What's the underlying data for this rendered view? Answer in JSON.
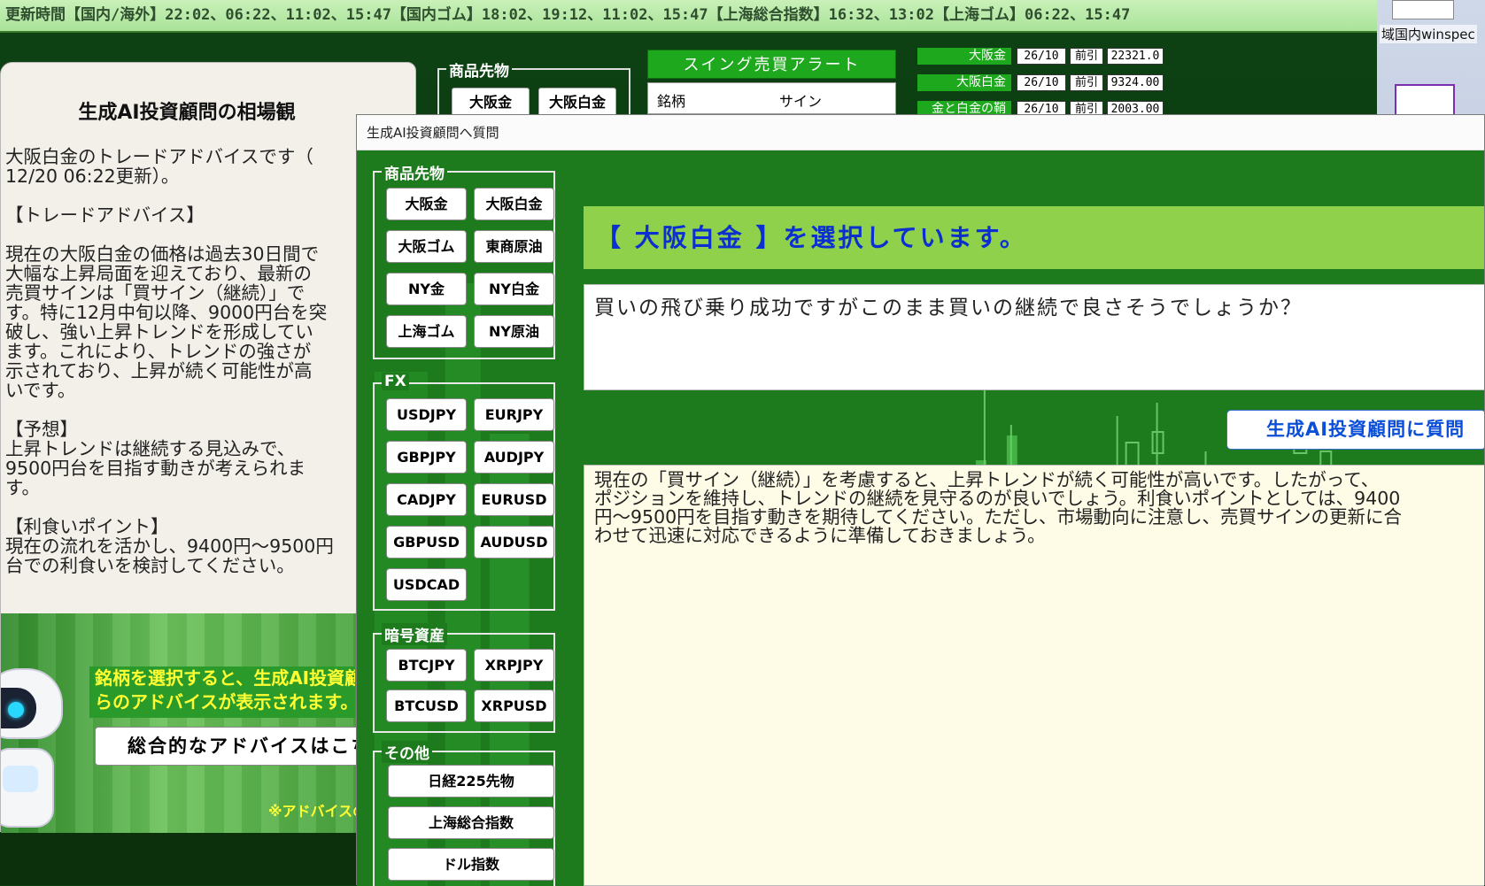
{
  "ticker": {
    "text": "更新時間【国内/海外】22:02、06:22、11:02、15:47【国内ゴム】18:02、19:12、11:02、15:47【上海総合指数】16:32、13:02【上海ゴム】06:22、15:47"
  },
  "desktop": {
    "icon_label": "域国内winspec"
  },
  "back_app": {
    "commodity_group_title": "商品先物",
    "commodity_buttons": [
      "大阪金",
      "大阪白金"
    ],
    "swing_alert_title": "スイング売買アラート",
    "swing_table_headers": [
      "銘柄",
      "サイン"
    ],
    "price_rows": [
      {
        "name": "大阪金",
        "month": "26/10",
        "type": "前引",
        "price": "22321.0"
      },
      {
        "name": "大阪白金",
        "month": "26/10",
        "type": "前引",
        "price": "9324.00"
      },
      {
        "name": "金と白金の鞘",
        "month": "26/10",
        "type": "前引",
        "price": "2003.00"
      }
    ]
  },
  "advice_window": {
    "title": "生成AI投資顧問の相場観",
    "body": "大阪白金のトレードアドバイスです（\n12/20 06:22更新）。\n\n【トレードアドバイス】\n\n現在の大阪白金の価格は過去30日間で\n大幅な上昇局面を迎えており、最新の\n売買サインは「買サイン（継続）」で\nす。特に12月中旬以降、9000円台を突\n破し、強い上昇トレンドを形成してい\nます。これにより、トレンドの強さが\n示されており、上昇が続く可能性が高\nいです。\n\n【予想】\n上昇トレンドは継続する見込みで、\n9500円台を目指す動きが考えられま\nす。\n\n【利食いポイント】\n現在の流れを活かし、9400円〜9500円\n台での利食いを検討してください。",
    "banner_text_line1": "銘柄を選択すると、生成AI投資顧問か",
    "banner_text_line2": "らのアドバイスが表示されます。",
    "banner_button": "総合的なアドバイスはこちら",
    "banner_note": "※アドバイスの"
  },
  "dialog": {
    "title": "生成AI投資顧問へ質問",
    "groups": {
      "commodity": {
        "title": "商品先物",
        "buttons": [
          "大阪金",
          "大阪白金",
          "大阪ゴム",
          "東商原油",
          "NY金",
          "NY白金",
          "上海ゴム",
          "NY原油"
        ]
      },
      "fx": {
        "title": "FX",
        "buttons": [
          "USDJPY",
          "EURJPY",
          "GBPJPY",
          "AUDJPY",
          "CADJPY",
          "EURUSD",
          "GBPUSD",
          "AUDUSD",
          "USDCAD"
        ]
      },
      "crypto": {
        "title": "暗号資産",
        "buttons": [
          "BTCJPY",
          "XRPJPY",
          "BTCUSD",
          "XRPUSD"
        ]
      },
      "other": {
        "title": "その他",
        "buttons": [
          "日経225先物",
          "上海総合指数",
          "ドル指数"
        ]
      }
    },
    "selected_header": "【 大阪白金 】を選択しています。",
    "question_text": "買いの飛び乗り成功ですがこのまま買いの継続で良さそうでしょうか？",
    "ask_button": "生成AI投資顧問に質問",
    "answer_text": "現在の「買サイン（継続）」を考慮すると、上昇トレンドが続く可能性が高いです。したがって、\nポジションを維持し、トレンドの継続を見守るのが良いでしょう。利食いポイントとしては、9400\n円〜9500円を目指す動きを期待してください。ただし、市場動向に注意し、売買サインの更新に合\nわせて迅速に対応できるように準備しておきましょう。"
  },
  "colors": {
    "dialog_green": "#1d7a1d",
    "header_lime": "#8fd14a",
    "accent_blue": "#0b4fd8",
    "answer_bg": "#fefce6"
  }
}
